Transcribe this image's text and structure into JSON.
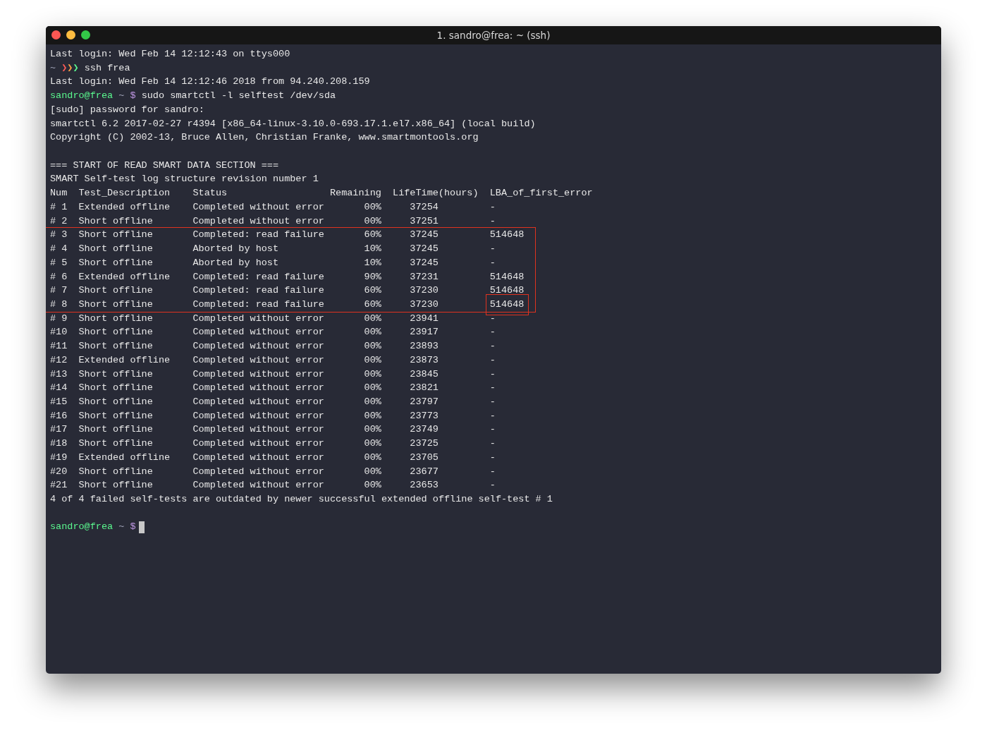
{
  "window": {
    "title": "1. sandro@frea: ~ (ssh)"
  },
  "before": [
    {
      "kind": "text",
      "text": "Last login: Wed Feb 14 12:12:43 on ttys000"
    },
    {
      "kind": "arrow_prompt",
      "tilde": "~",
      "arrows": [
        {
          "char": "❯",
          "color": "#ff5c57"
        },
        {
          "char": "❯",
          "color": "#ff9f43"
        },
        {
          "char": "❯",
          "color": "#5af78e"
        }
      ],
      "command": "ssh frea"
    },
    {
      "kind": "text",
      "text": "Last login: Wed Feb 14 12:12:46 2018 from 94.240.208.159"
    },
    {
      "kind": "prompt",
      "user": "sandro@frea",
      "path": "~",
      "symbol": "$",
      "command": "sudo smartctl -l selftest /dev/sda"
    },
    {
      "kind": "text",
      "text": "[sudo] password for sandro:"
    },
    {
      "kind": "text",
      "text": "smartctl 6.2 2017-02-27 r4394 [x86_64-linux-3.10.0-693.17.1.el7.x86_64] (local build)"
    },
    {
      "kind": "text",
      "text": "Copyright (C) 2002-13, Bruce Allen, Christian Franke, www.smartmontools.org"
    },
    {
      "kind": "blank"
    },
    {
      "kind": "text",
      "text": "=== START OF READ SMART DATA SECTION ==="
    },
    {
      "kind": "text",
      "text": "SMART Self-test log structure revision number 1"
    }
  ],
  "table": {
    "columns": [
      "Num",
      "Test_Description",
      "Status",
      "Remaining",
      "LifeTime(hours)",
      "LBA_of_first_error"
    ],
    "row_groups": [
      {
        "highlighted": false,
        "rows": [
          {
            "cells": [
              "# 1",
              "Extended offline",
              "Completed without error",
              "00%",
              "37254",
              "-"
            ],
            "lba_boxed": false
          },
          {
            "cells": [
              "# 2",
              "Short offline",
              "Completed without error",
              "00%",
              "37251",
              "-"
            ],
            "lba_boxed": false
          }
        ]
      },
      {
        "highlighted": true,
        "rows": [
          {
            "cells": [
              "# 3",
              "Short offline",
              "Completed: read failure",
              "60%",
              "37245",
              "514648"
            ],
            "lba_boxed": false
          },
          {
            "cells": [
              "# 4",
              "Short offline",
              "Aborted by host",
              "10%",
              "37245",
              "-"
            ],
            "lba_boxed": false
          },
          {
            "cells": [
              "# 5",
              "Short offline",
              "Aborted by host",
              "10%",
              "37245",
              "-"
            ],
            "lba_boxed": false
          },
          {
            "cells": [
              "# 6",
              "Extended offline",
              "Completed: read failure",
              "90%",
              "37231",
              "514648"
            ],
            "lba_boxed": false
          },
          {
            "cells": [
              "# 7",
              "Short offline",
              "Completed: read failure",
              "60%",
              "37230",
              "514648"
            ],
            "lba_boxed": false
          },
          {
            "cells": [
              "# 8",
              "Short offline",
              "Completed: read failure",
              "60%",
              "37230",
              "514648"
            ],
            "lba_boxed": true
          }
        ]
      },
      {
        "highlighted": false,
        "rows": [
          {
            "cells": [
              "# 9",
              "Short offline",
              "Completed without error",
              "00%",
              "23941",
              "-"
            ],
            "lba_boxed": false
          },
          {
            "cells": [
              "#10",
              "Short offline",
              "Completed without error",
              "00%",
              "23917",
              "-"
            ],
            "lba_boxed": false
          },
          {
            "cells": [
              "#11",
              "Short offline",
              "Completed without error",
              "00%",
              "23893",
              "-"
            ],
            "lba_boxed": false
          },
          {
            "cells": [
              "#12",
              "Extended offline",
              "Completed without error",
              "00%",
              "23873",
              "-"
            ],
            "lba_boxed": false
          },
          {
            "cells": [
              "#13",
              "Short offline",
              "Completed without error",
              "00%",
              "23845",
              "-"
            ],
            "lba_boxed": false
          },
          {
            "cells": [
              "#14",
              "Short offline",
              "Completed without error",
              "00%",
              "23821",
              "-"
            ],
            "lba_boxed": false
          },
          {
            "cells": [
              "#15",
              "Short offline",
              "Completed without error",
              "00%",
              "23797",
              "-"
            ],
            "lba_boxed": false
          },
          {
            "cells": [
              "#16",
              "Short offline",
              "Completed without error",
              "00%",
              "23773",
              "-"
            ],
            "lba_boxed": false
          },
          {
            "cells": [
              "#17",
              "Short offline",
              "Completed without error",
              "00%",
              "23749",
              "-"
            ],
            "lba_boxed": false
          },
          {
            "cells": [
              "#18",
              "Short offline",
              "Completed without error",
              "00%",
              "23725",
              "-"
            ],
            "lba_boxed": false
          },
          {
            "cells": [
              "#19",
              "Extended offline",
              "Completed without error",
              "00%",
              "23705",
              "-"
            ],
            "lba_boxed": false
          },
          {
            "cells": [
              "#20",
              "Short offline",
              "Completed without error",
              "00%",
              "23677",
              "-"
            ],
            "lba_boxed": false
          },
          {
            "cells": [
              "#21",
              "Short offline",
              "Completed without error",
              "00%",
              "23653",
              "-"
            ],
            "lba_boxed": false
          }
        ]
      }
    ]
  },
  "after": [
    {
      "kind": "text",
      "text": "4 of 4 failed self-tests are outdated by newer successful extended offline self-test # 1"
    },
    {
      "kind": "blank"
    },
    {
      "kind": "prompt",
      "user": "sandro@frea",
      "path": "~",
      "symbol": "$",
      "cursor": true
    }
  ]
}
